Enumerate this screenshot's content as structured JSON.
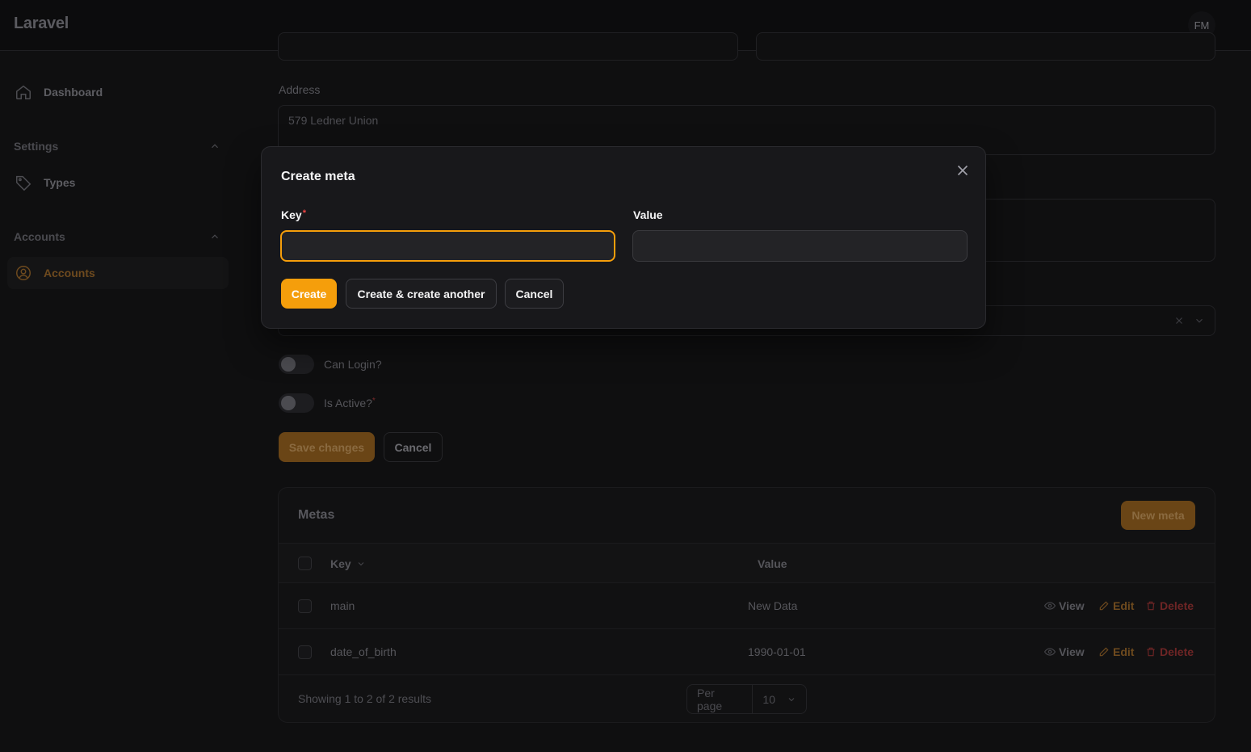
{
  "app": {
    "brand": "Laravel",
    "user_initials": "FM"
  },
  "sidebar": {
    "dashboard": "Dashboard",
    "groups": [
      {
        "label": "Settings",
        "items": [
          "Types"
        ]
      },
      {
        "label": "Accounts",
        "items": [
          "Accounts"
        ]
      }
    ]
  },
  "form": {
    "address_label": "Address",
    "address_value": "579 Ledner Union",
    "can_login_label": "Can Login?",
    "is_active_label": "Is Active?",
    "required_marker": "*",
    "save_label": "Save changes",
    "cancel_label": "Cancel"
  },
  "metas": {
    "title": "Metas",
    "new_label": "New meta",
    "columns": {
      "key": "Key",
      "value": "Value"
    },
    "rows": [
      {
        "key": "main",
        "value": "New Data"
      },
      {
        "key": "date_of_birth",
        "value": "1990-01-01"
      }
    ],
    "actions": {
      "view": "View",
      "edit": "Edit",
      "delete": "Delete"
    },
    "footer": "Showing 1 to 2 of 2 results",
    "per_page_label": "Per page",
    "per_page_value": "10"
  },
  "modal": {
    "title": "Create meta",
    "key_label": "Key",
    "required_marker": "*",
    "value_label": "Value",
    "key_value": "",
    "value_value": "",
    "create_label": "Create",
    "create_another_label": "Create & create another",
    "cancel_label": "Cancel"
  },
  "colors": {
    "accent": "#f59e0b",
    "danger": "#ef4444",
    "background": "#0f0f10",
    "modal": "#18181b"
  }
}
